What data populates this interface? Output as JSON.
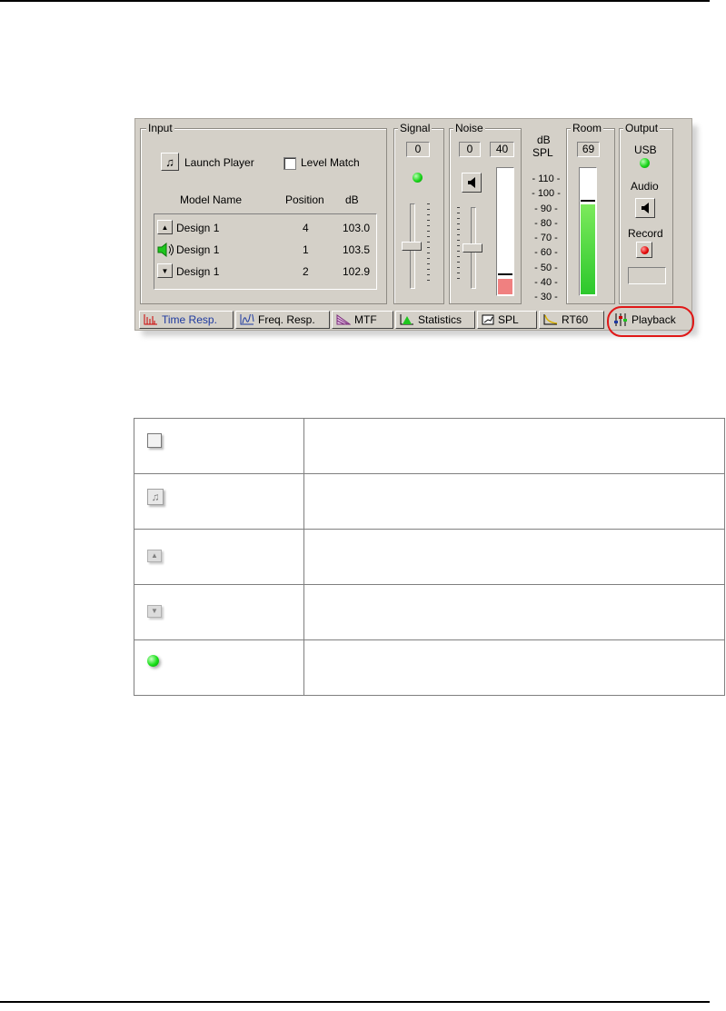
{
  "panel": {
    "input_legend": "Input",
    "launch_player": "Launch Player",
    "level_match": "Level Match",
    "columns": [
      "Model Name",
      "Position",
      "dB"
    ],
    "rows": [
      {
        "name": "Design 1",
        "position": "4",
        "db": "103.0",
        "icon": "up-arrow-icon"
      },
      {
        "name": "Design 1",
        "position": "1",
        "db": "103.5",
        "icon": "speaker-icon"
      },
      {
        "name": "Design 1",
        "position": "2",
        "db": "102.9",
        "icon": "down-arrow-icon"
      }
    ],
    "signal_legend": "Signal",
    "signal_value": "0",
    "noise_legend": "Noise",
    "noise_value1": "0",
    "noise_value2": "40",
    "db_label": "dB",
    "spl_label": "SPL",
    "scale": [
      "- 110 -",
      "- 100 -",
      "- 90 -",
      "- 80 -",
      "- 70 -",
      "- 60 -",
      "- 50 -",
      "- 40 -",
      "- 30 -"
    ],
    "room_legend": "Room",
    "room_value": "69",
    "room_level_fraction": 0.72,
    "noise_level_fraction": 0.12,
    "output_legend": "Output",
    "usb_label": "USB",
    "audio_label": "Audio",
    "record_label": "Record"
  },
  "tabs": [
    {
      "label": "Time Resp.",
      "icon": "time-response-icon",
      "active": true
    },
    {
      "label": "Freq. Resp.",
      "icon": "frequency-response-icon",
      "active": false
    },
    {
      "label": "MTF",
      "icon": "mtf-icon",
      "active": false
    },
    {
      "label": "Statistics",
      "icon": "statistics-icon",
      "active": false
    },
    {
      "label": "SPL",
      "icon": "spl-icon",
      "active": false
    },
    {
      "label": "RT60",
      "icon": "rt60-icon",
      "active": false
    },
    {
      "label": "Playback",
      "icon": "playback-icon",
      "active": false,
      "highlighted": true
    }
  ],
  "colors": {
    "highlight_ring": "#e01818",
    "panel_bg": "#d4d0c8",
    "led_green": "#19d419",
    "noise_fill": "#f08080",
    "room_fill": "#3cd43c"
  },
  "legend_table_icons": [
    "checkbox-icon",
    "music-note-button-icon",
    "up-arrow-button-icon",
    "down-arrow-button-icon",
    "green-led-icon"
  ]
}
